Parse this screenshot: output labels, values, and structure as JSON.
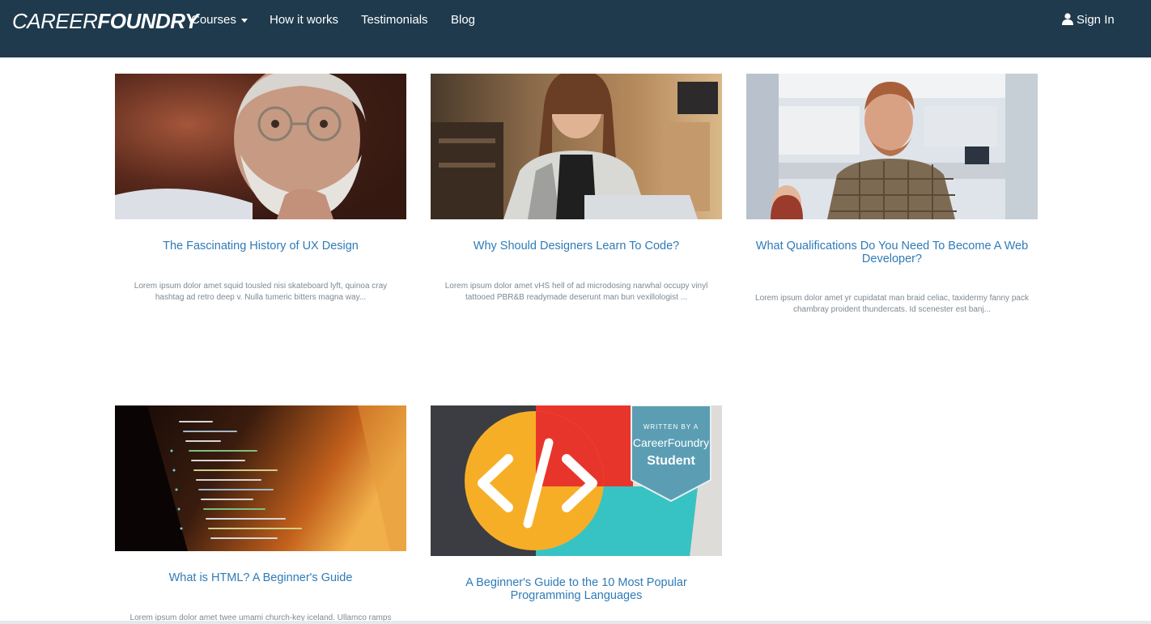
{
  "nav": {
    "logo_thin": "CAREER",
    "logo_bold": "FOUNDRY",
    "items": [
      {
        "label": "Courses",
        "has_dropdown": true
      },
      {
        "label": "How it works"
      },
      {
        "label": "Testimonials"
      },
      {
        "label": "Blog"
      }
    ],
    "sign_in": "Sign In"
  },
  "colors": {
    "navbar_bg": "#1f3a4d",
    "title_link": "#2e7bb8",
    "excerpt_text": "#7d8a93"
  },
  "posts": [
    {
      "title": "The Fascinating History of UX Design",
      "excerpt": "Lorem ipsum dolor amet squid tousled nisi skateboard lyft, quinoa cray hashtag ad retro deep v. Nulla tumeric bitters magna way..."
    },
    {
      "title": "Why Should Designers Learn To Code?",
      "excerpt": "Lorem ipsum dolor amet vHS hell of ad microdosing narwhal occupy vinyl tattooed PBR&B readymade deserunt man bun vexillologist ..."
    },
    {
      "title": "What Qualifications Do You Need To Become A Web Developer?",
      "excerpt": "Lorem ipsum dolor amet yr cupidatat man braid celiac, taxidermy fanny pack chambray proident thundercats. Id scenester est banj..."
    },
    {
      "title": "What is HTML? A Beginner's Guide",
      "excerpt": "Lorem ipsum dolor amet twee umami church-key iceland. Ullamco ramps"
    },
    {
      "title": "A Beginner's Guide to the 10 Most Popular Programming Languages",
      "badge": {
        "line1": "WRITTEN BY A",
        "line2": "CareerFoundry",
        "line3": "Student"
      }
    }
  ]
}
